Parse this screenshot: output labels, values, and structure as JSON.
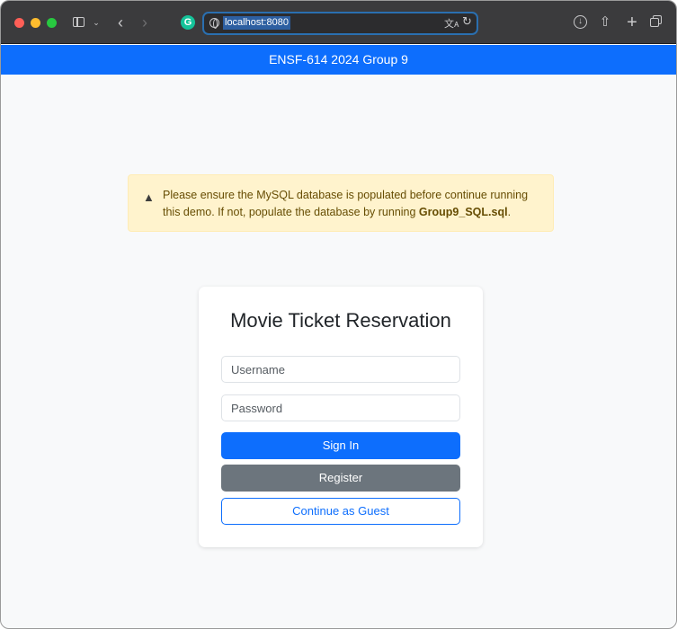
{
  "browser": {
    "url": "localhost:8080",
    "icons": [
      "sidebar-icon",
      "chevron-down-icon",
      "back-icon",
      "forward-icon",
      "grammarly-icon",
      "globe-icon",
      "translate-icon",
      "reload-icon",
      "download-icon",
      "share-icon",
      "new-tab-icon",
      "tab-overview-icon"
    ]
  },
  "navbar": {
    "title": "ENSF-614 2024 Group 9",
    "color": "#0d6efd"
  },
  "alert": {
    "text": "Please ensure the MySQL database is populated before continue running this demo. If not, populate the database by running ",
    "filename": "Group9_SQL.sql",
    "text_end": ".",
    "color": "#fff3cd",
    "icon": "warning-icon"
  },
  "login": {
    "title": "Movie Ticket Reservation",
    "username_placeholder": "Username",
    "password_placeholder": "Password",
    "signin_label": "Sign In",
    "register_label": "Register",
    "guest_label": "Continue as Guest"
  }
}
